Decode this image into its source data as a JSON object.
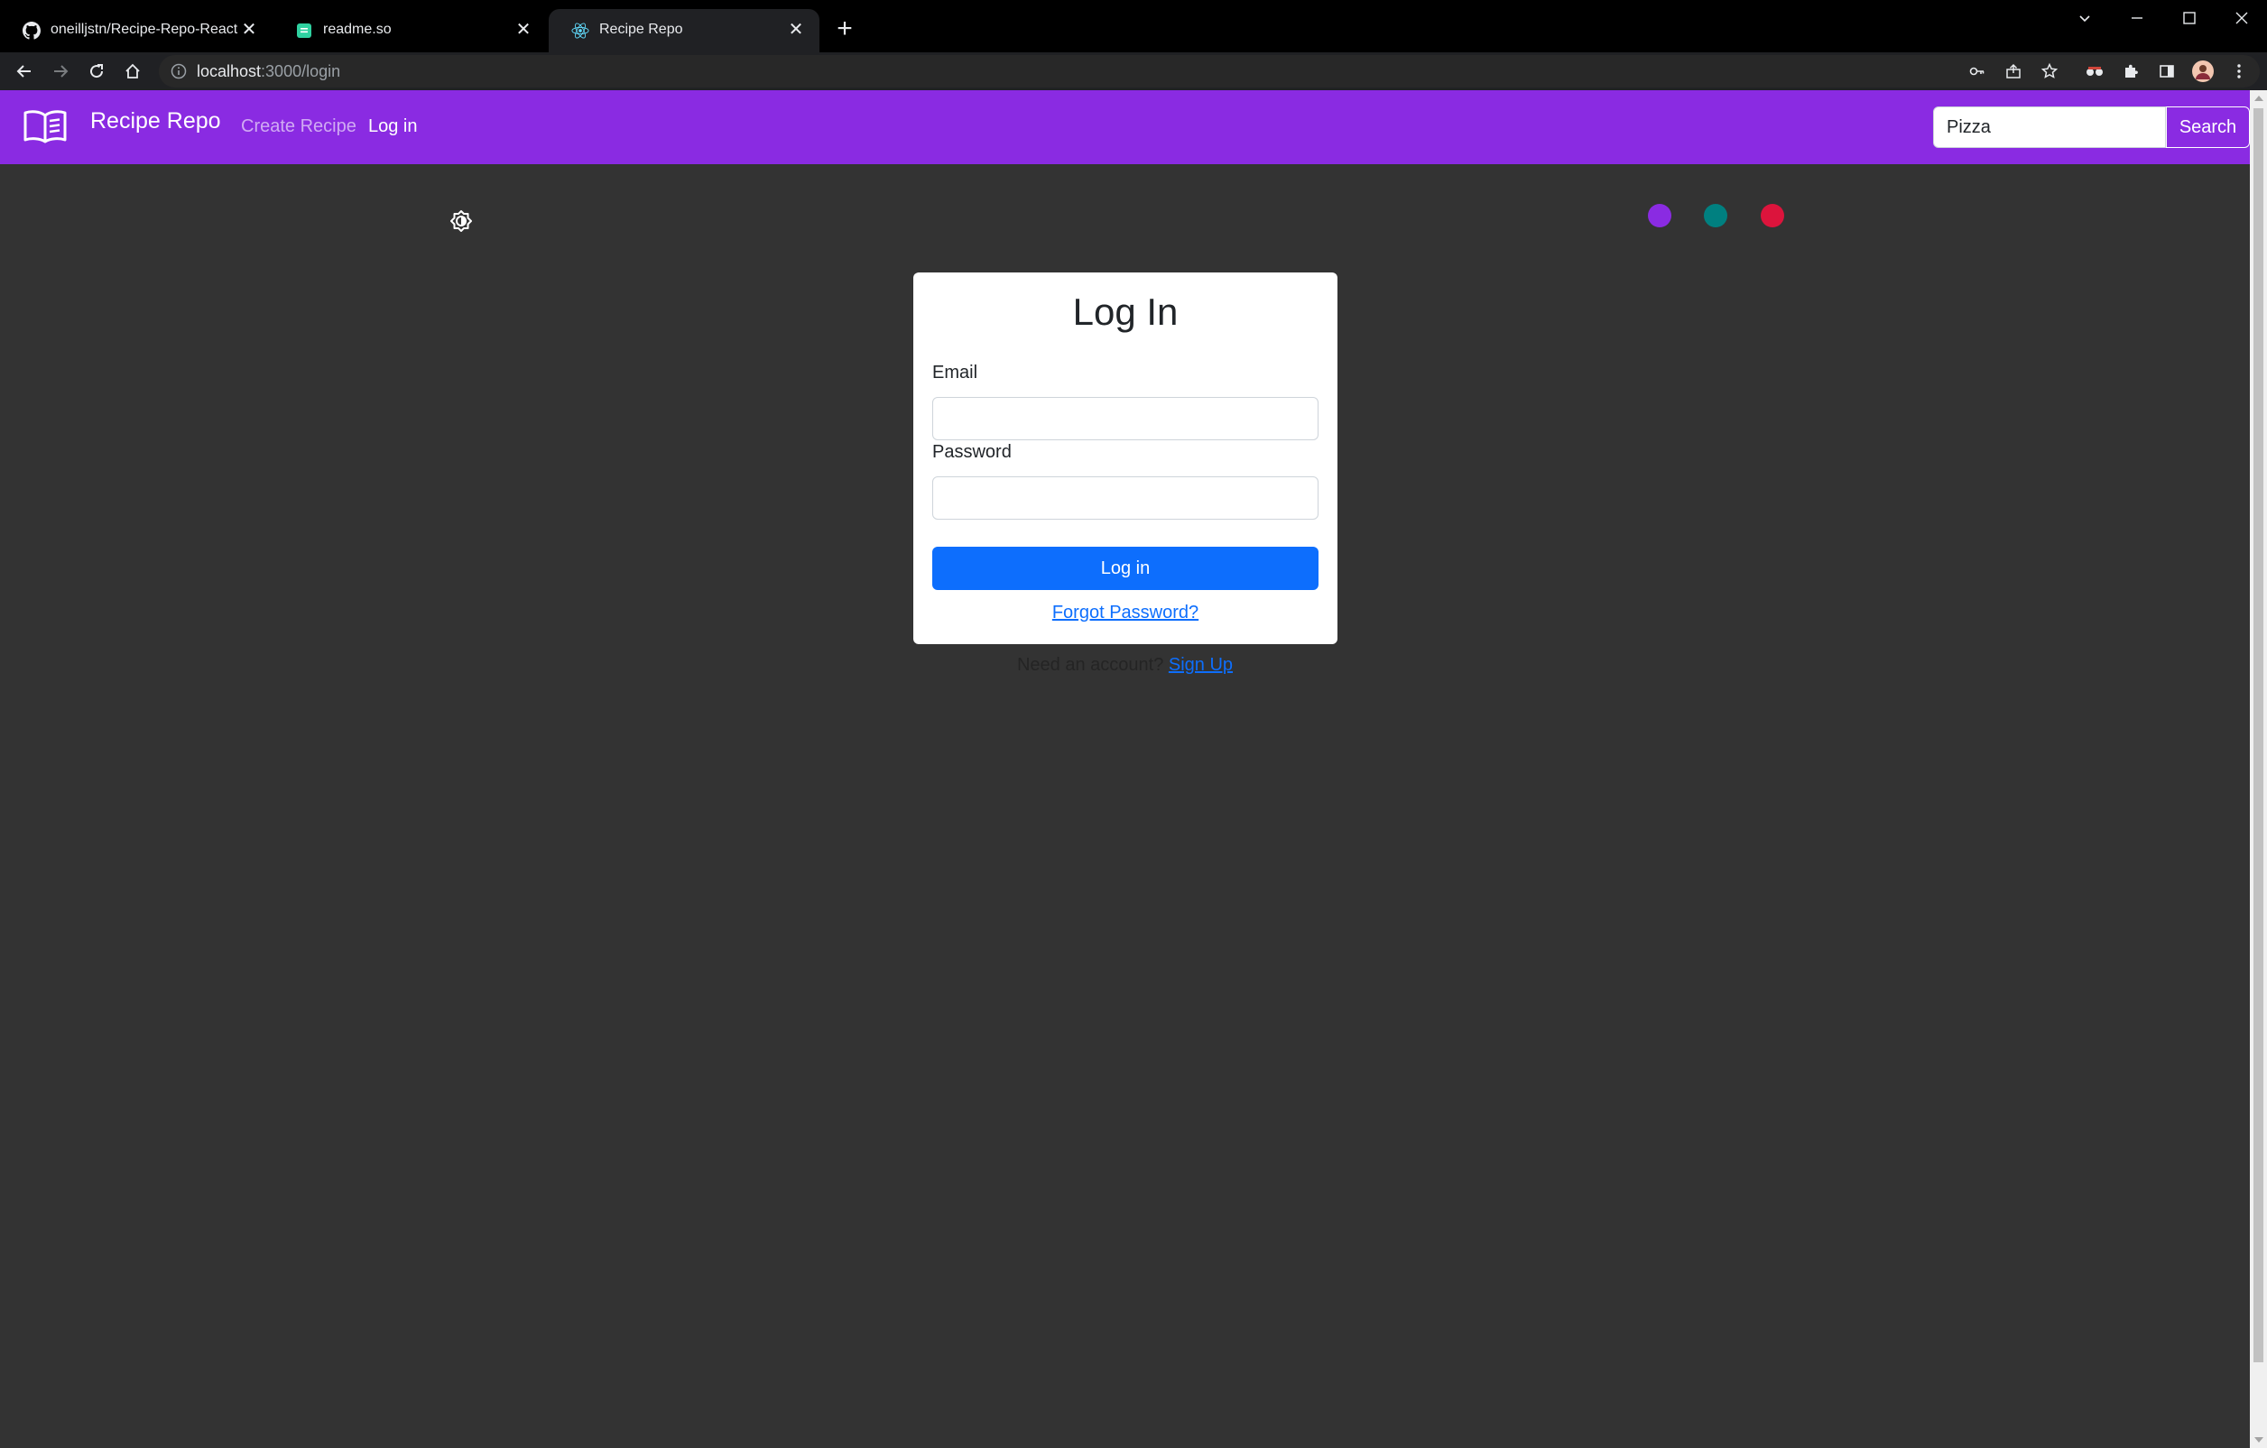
{
  "browser": {
    "tabs": [
      {
        "title": "oneilljstn/Recipe-Repo-React",
        "icon": "github-icon",
        "active": false
      },
      {
        "title": "readme.so",
        "icon": "readme-so-icon",
        "active": false
      },
      {
        "title": "Recipe Repo",
        "icon": "react-icon",
        "active": true
      }
    ],
    "url_host": "localhost",
    "url_rest": ":3000/login"
  },
  "navbar": {
    "brand": "Recipe Repo",
    "links": [
      {
        "label": "Create Recipe",
        "active": false
      },
      {
        "label": "Log in",
        "active": true
      }
    ],
    "search_value": "Pizza",
    "search_button": "Search"
  },
  "theme": {
    "colors": [
      "#8a2be2",
      "#008080",
      "#dc143c"
    ]
  },
  "login": {
    "title": "Log In",
    "email_label": "Email",
    "email_value": "",
    "password_label": "Password",
    "password_value": "",
    "submit_label": "Log in",
    "forgot_label": "Forgot Password?",
    "need_account_text": "Need an account?",
    "signup_label": "Sign Up"
  },
  "colors": {
    "navbar_bg": "#8a2be2",
    "page_bg": "#333333",
    "primary": "#0d6efd"
  }
}
